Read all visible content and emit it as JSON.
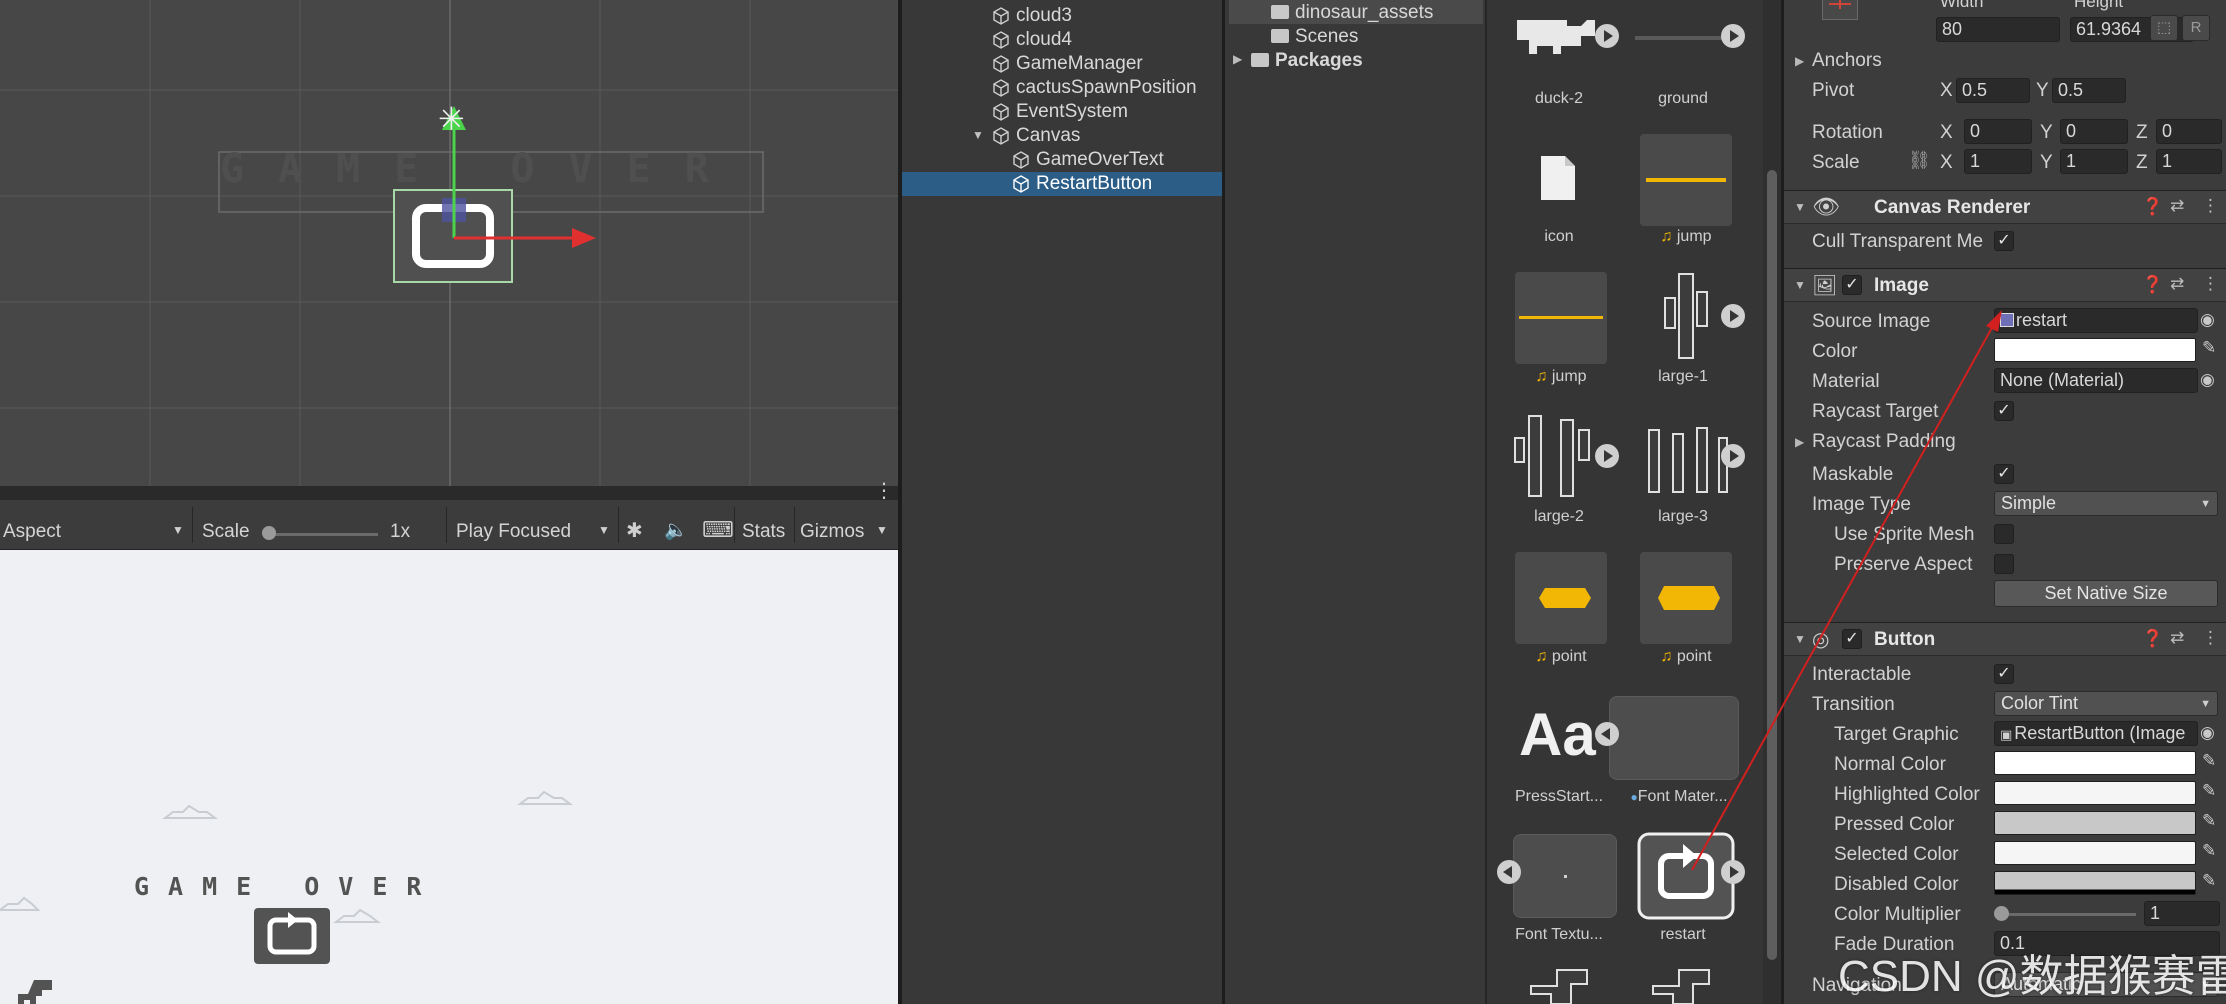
{
  "scene": {
    "game_over_text": "GAME OVER"
  },
  "game_toolbar": {
    "aspect": "Aspect",
    "scale_label": "Scale",
    "scale_value": "1x",
    "play_focused": "Play Focused",
    "stats": "Stats",
    "gizmos": "Gizmos"
  },
  "game_view": {
    "game_over_text": "GAME OVER"
  },
  "hierarchy": {
    "items": [
      {
        "label": "cloud3"
      },
      {
        "label": "cloud4"
      },
      {
        "label": "GameManager"
      },
      {
        "label": "cactusSpawnPosition"
      },
      {
        "label": "EventSystem"
      },
      {
        "label": "Canvas"
      },
      {
        "label": "GameOverText"
      },
      {
        "label": "RestartButton"
      }
    ]
  },
  "project": {
    "folders": [
      {
        "label": "dinosaur_assets"
      },
      {
        "label": "Scenes"
      },
      {
        "label": "Packages"
      }
    ],
    "assets": [
      {
        "label": "duck-2"
      },
      {
        "label": "ground"
      },
      {
        "label": "icon"
      },
      {
        "label": "jump"
      },
      {
        "label": "jump"
      },
      {
        "label": "large-1"
      },
      {
        "label": "large-2"
      },
      {
        "label": "large-3"
      },
      {
        "label": "point"
      },
      {
        "label": "point"
      },
      {
        "label": "PressStart..."
      },
      {
        "label": "Font Mater..."
      },
      {
        "label": "Font Textu..."
      },
      {
        "label": "restart"
      }
    ]
  },
  "inspector": {
    "rect": {
      "width_label": "Width",
      "height_label": "Height",
      "width_value": "80",
      "height_value": "61.9364",
      "anchors_label": "Anchors",
      "pivot_label": "Pivot",
      "pivot_x": "0.5",
      "pivot_y": "0.5",
      "rotation_label": "Rotation",
      "rotation_x": "0",
      "rotation_y": "0",
      "rotation_z": "0",
      "scale_label": "Scale",
      "scale_x": "1",
      "scale_y": "1",
      "scale_z": "1",
      "x": "X",
      "y": "Y",
      "z": "Z"
    },
    "canvas_renderer": {
      "title": "Canvas Renderer",
      "cull_label": "Cull Transparent Me"
    },
    "image": {
      "title": "Image",
      "source_image_label": "Source Image",
      "source_image_value": "restart",
      "color_label": "Color",
      "material_label": "Material",
      "material_value": "None (Material)",
      "raycast_target_label": "Raycast Target",
      "raycast_padding_label": "Raycast Padding",
      "maskable_label": "Maskable",
      "image_type_label": "Image Type",
      "image_type_value": "Simple",
      "use_sprite_mesh_label": "Use Sprite Mesh",
      "preserve_aspect_label": "Preserve Aspect",
      "set_native_size": "Set Native Size"
    },
    "button": {
      "title": "Button",
      "interactable_label": "Interactable",
      "transition_label": "Transition",
      "transition_value": "Color Tint",
      "target_graphic_label": "Target Graphic",
      "target_graphic_value": "RestartButton (Image",
      "normal_color_label": "Normal Color",
      "highlighted_color_label": "Highlighted Color",
      "pressed_color_label": "Pressed Color",
      "selected_color_label": "Selected Color",
      "disabled_color_label": "Disabled Color",
      "color_multiplier_label": "Color Multiplier",
      "color_multiplier_value": "1",
      "fade_duration_label": "Fade Duration",
      "fade_duration_value": "0.1",
      "navigation_label": "Navigation",
      "navigation_value": "Automatic"
    }
  },
  "watermark": "CSDN @数据猴赛雷",
  "colors": {
    "selection": "#2c5d87",
    "accent_arrow": "#d21f1f",
    "audio_icon": "#f2b705"
  }
}
